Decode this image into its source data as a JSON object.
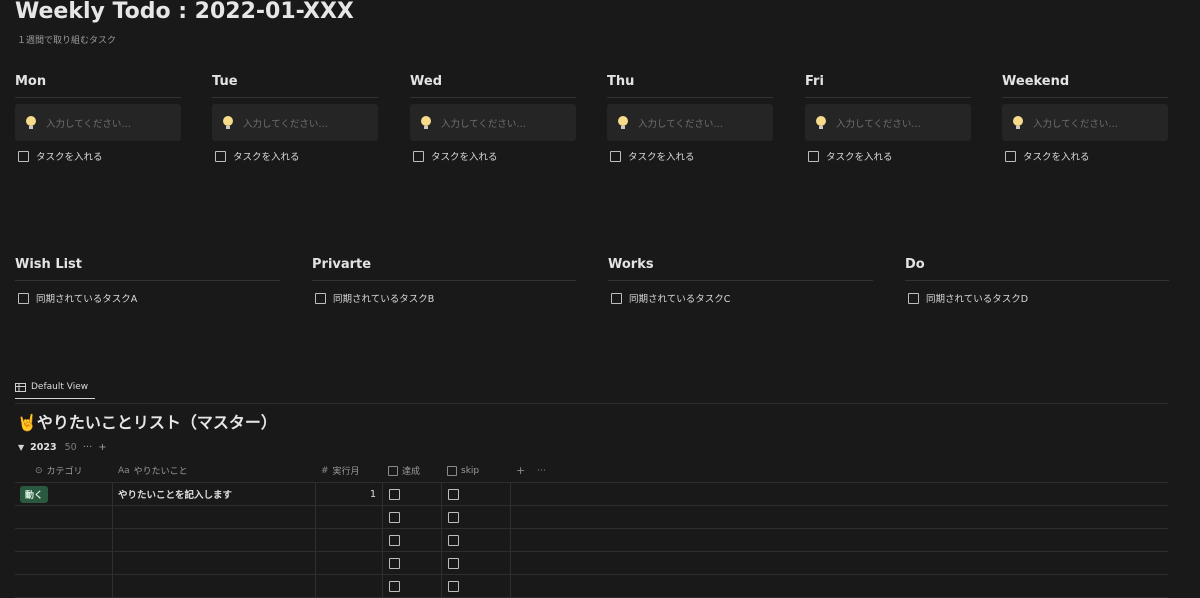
{
  "page": {
    "title": "Weekly Todo : 2022-01-XXX",
    "subtitle": "１週間で取り組むタスク"
  },
  "days": [
    {
      "name": "Mon",
      "placeholder": "入力してください…",
      "task": "タスクを入れる"
    },
    {
      "name": "Tue",
      "placeholder": "入力してください…",
      "task": "タスクを入れる"
    },
    {
      "name": "Wed",
      "placeholder": "入力してください…",
      "task": "タスクを入れる"
    },
    {
      "name": "Thu",
      "placeholder": "入力してください…",
      "task": "タスクを入れる"
    },
    {
      "name": "Fri",
      "placeholder": "入力してください…",
      "task": "タスクを入れる"
    },
    {
      "name": "Weekend",
      "placeholder": "入力してください…",
      "task": "タスクを入れる"
    }
  ],
  "lists": [
    {
      "name": "Wish List",
      "task": "同期されているタスクA"
    },
    {
      "name": "Privarte",
      "task": "同期されているタスクB"
    },
    {
      "name": "Works",
      "task": "同期されているタスクC"
    },
    {
      "name": "Do",
      "task": "同期されているタスクD"
    }
  ],
  "database": {
    "view_tab": "Default View",
    "title_emoji": "🤘",
    "title": "やりたいことリスト（マスター）",
    "group": {
      "name": "2023",
      "count": "50",
      "more_icon": "···",
      "add_icon": "+"
    },
    "columns": [
      {
        "icon": "⊙",
        "label": "カテゴリ"
      },
      {
        "icon": "Aa",
        "label": "やりたいこと"
      },
      {
        "icon": "#",
        "label": "実行月"
      },
      {
        "icon": "checkbox",
        "label": "達成"
      },
      {
        "icon": "checkbox",
        "label": "skip"
      }
    ],
    "header_actions": {
      "add": "+",
      "more": "···"
    },
    "rows": [
      {
        "category": "動く",
        "task": "やりたいことを記入します",
        "month": "1",
        "done": false,
        "skip": false
      },
      {
        "category": "",
        "task": "",
        "month": "",
        "done": false,
        "skip": false
      },
      {
        "category": "",
        "task": "",
        "month": "",
        "done": false,
        "skip": false
      },
      {
        "category": "",
        "task": "",
        "month": "",
        "done": false,
        "skip": false
      },
      {
        "category": "",
        "task": "",
        "month": "",
        "done": false,
        "skip": false
      }
    ],
    "tag_color": "#2b593f"
  },
  "colors": {
    "background": "#191919",
    "text": "#d4d4d4",
    "callout": "#252525"
  }
}
